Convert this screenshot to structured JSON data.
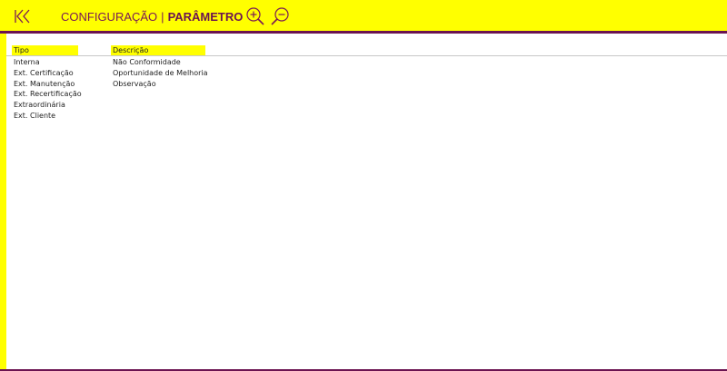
{
  "header": {
    "title_section": "CONFIGURAÇÃO",
    "separator": "|",
    "title_page": "PARÂMETRO",
    "icons": {
      "back": "first-page-icon",
      "zoom_in": "zoom-in-icon",
      "zoom_out": "zoom-out-icon"
    }
  },
  "tipo": {
    "header": "Tipo",
    "items": [
      "Interna",
      "Ext. Certificação",
      "Ext. Manutenção",
      "Ext. Recertificação",
      "Extraordinária",
      "Ext. Cliente"
    ]
  },
  "descricao": {
    "header": "Descrição",
    "items": [
      "Não Conformidade",
      "Oportunidade de Melhoria",
      "Observação"
    ]
  },
  "colors": {
    "accent": "#ffff00",
    "brand": "#6b1451"
  }
}
